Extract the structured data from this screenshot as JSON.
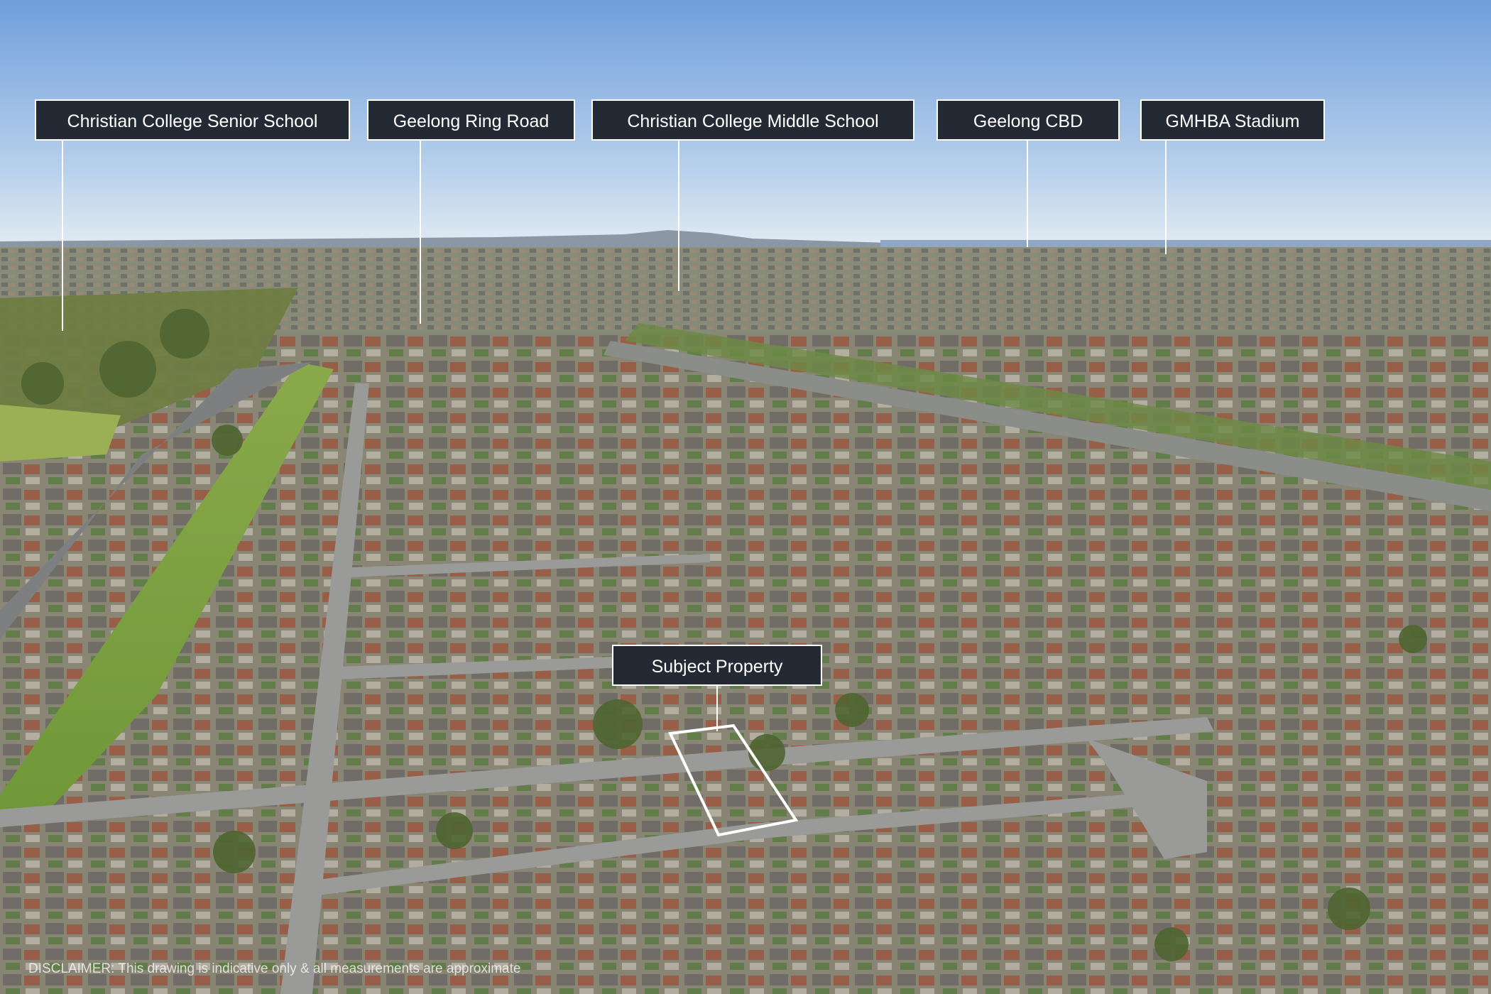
{
  "colors": {
    "sky_top": "#7aa6dc",
    "sky_horizon": "#dbe7f1",
    "label_bg": "#232a33",
    "label_text": "#ffffff",
    "leader_line": "#ffffff",
    "outline": "#ffffff"
  },
  "callouts": [
    {
      "id": "senior-school",
      "label": "Christian College Senior School"
    },
    {
      "id": "ring-road",
      "label": "Geelong Ring Road"
    },
    {
      "id": "middle-school",
      "label": "Christian College Middle School"
    },
    {
      "id": "cbd",
      "label": "Geelong CBD"
    },
    {
      "id": "stadium",
      "label": "GMHBA Stadium"
    }
  ],
  "subject": {
    "label": "Subject Property"
  },
  "disclaimer": "DISCLAIMER: This drawing is indicative only & all measurements are approximate"
}
